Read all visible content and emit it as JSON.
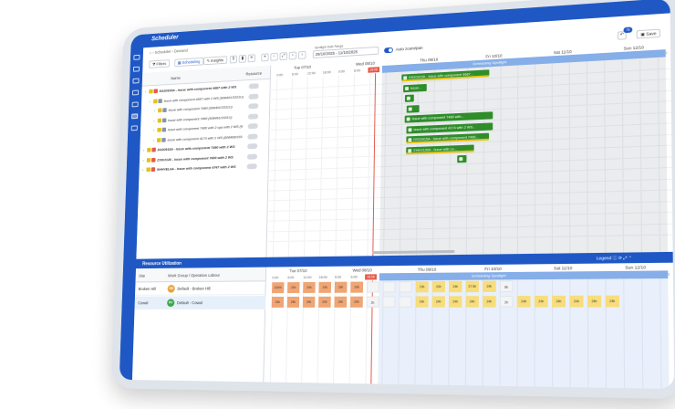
{
  "app": {
    "title": "Scheduler"
  },
  "breadcrumb": [
    "Scheduler",
    "Demand"
  ],
  "toolbar": {
    "filters_label": "Filters",
    "scheduling_label": "Scheduling",
    "insights_label": "Insights",
    "spotlight_label": "Spotlight Date Range",
    "date_range": "29/10/2025 - 11/10/2025",
    "auto_zoom_label": "Auto zoom/pan",
    "save_label": "Save",
    "undo_badge": "76"
  },
  "gantt": {
    "columns": {
      "name": "Name",
      "resource": "Resource"
    },
    "days": [
      "Tue 07/10",
      "Wed 08/10",
      "Thu 09/10",
      "Fri 10/10",
      "Sat 11/10",
      "Sun 12/10"
    ],
    "hours": [
      "0:00",
      "6:00",
      "12:00",
      "18:00"
    ],
    "now_marker": "18:08",
    "spotlight_label": "Scheduling Spotlight",
    "rows": [
      {
        "label": "DS20915A - Issue with component 4687 with 2 WS",
        "level": 0
      },
      {
        "label": "Issue with component 4687 with 2 WS (608461/3331U)",
        "level": 1
      },
      {
        "label": "Issue with component 7680 (608461/3331U)",
        "level": 2
      },
      {
        "label": "Issue with component 7480 (608461/3331U)",
        "level": 2
      },
      {
        "label": "Issue with component 7480 with 2 ops with 2 WS (608461/3331U)",
        "level": 2
      },
      {
        "label": "Issue with component 4174 with 2 WS (608468/3331U)",
        "level": 2
      },
      {
        "label": "DS20915A - Issue with component 7490 with 2 WS",
        "level": 0
      },
      {
        "label": "ZXKO126 - Issue with component 7480 with 2 WS",
        "level": 0
      },
      {
        "label": "SHHVEL6A - Issue with component 4747 with 2 WS",
        "level": 0
      }
    ],
    "bars": [
      {
        "label": "DS20915A - Issue with component 4687...",
        "row": 0,
        "warn": true
      },
      {
        "label": "Issue...",
        "row": 1,
        "warn": false
      },
      {
        "label": "",
        "row": 2,
        "warn": false
      },
      {
        "label": "",
        "row": 3,
        "warn": false
      },
      {
        "label": "Issue with component 7480 with...",
        "row": 4,
        "warn": false
      },
      {
        "label": "Issue with component 4174 with 2 WS...",
        "row": 5,
        "warn": false
      },
      {
        "label": "DS20915A - Issue with component 7490...",
        "row": 6,
        "warn": true
      },
      {
        "label": "ZXKO126A - Issue with co...",
        "row": 7,
        "warn": true
      },
      {
        "label": "",
        "row": 8,
        "warn": false
      }
    ]
  },
  "utilization": {
    "title": "Resource Utilization",
    "legend_label": "Legend",
    "columns": {
      "site": "Site",
      "work_group": "Work Group / Operation Labour"
    },
    "days": [
      "Tue 07/10",
      "Wed 08/10",
      "Thu 09/10",
      "Fri 10/10",
      "Sat 11/10",
      "Sun 12/10"
    ],
    "spotlight_label": "Scheduling Spotlight",
    "rows": [
      {
        "site": "Broken Hill",
        "avatar": "DB",
        "avatar_color": "#e8a33a",
        "work_group": "Default - Broken Hill",
        "cells": [
          "100%",
          "24h",
          "24h",
          "24h",
          "24h",
          "24h",
          "",
          "",
          "",
          "13h",
          "24h",
          "24h",
          "27.5h",
          "24h",
          "8h"
        ]
      },
      {
        "site": "Cowal",
        "avatar": "DC",
        "avatar_color": "#3aa64a",
        "work_group": "Default - Cowal",
        "cells": [
          "24h",
          "24h",
          "24h",
          "24h",
          "24h",
          "24h",
          "2h",
          "",
          "",
          "14h",
          "24h",
          "24h",
          "24h",
          "24h",
          "2h",
          "24h",
          "24h",
          "24h",
          "24h",
          "24h",
          "24h"
        ]
      }
    ]
  },
  "nav_icons": [
    "home-icon",
    "truck-icon",
    "calendar-icon",
    "chart-icon",
    "tool-icon",
    "list-icon",
    "calendar-grid-icon"
  ],
  "colors": {
    "brand": "#1f58c4",
    "bar_green": "#2f8d2a",
    "warn_yellow": "#e3c21c",
    "now_red": "#e45a4a",
    "cell_orange": "#f0a574",
    "cell_yellow": "#f7dd7c"
  }
}
